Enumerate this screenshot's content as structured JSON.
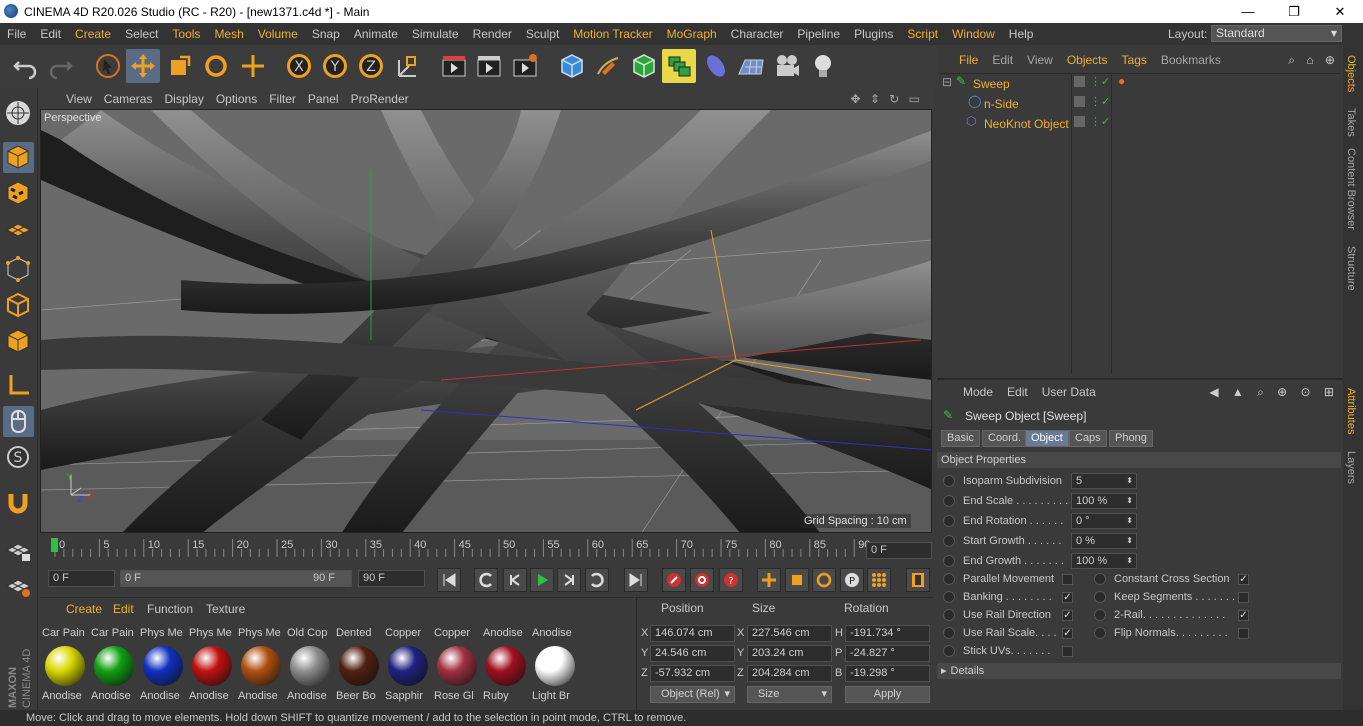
{
  "window": {
    "title": "CINEMA 4D R20.026 Studio (RC - R20) - [new1371.c4d *] - Main",
    "minimize_glyph": "—",
    "maximize_glyph": "❐",
    "close_glyph": "✕"
  },
  "menubar": {
    "items": [
      "File",
      "Edit",
      "Create",
      "Select",
      "Tools",
      "Mesh",
      "Volume",
      "Snap",
      "Animate",
      "Simulate",
      "Render",
      "Sculpt",
      "Motion Tracker",
      "MoGraph",
      "Character",
      "Pipeline",
      "Plugins",
      "Script",
      "Window",
      "Help"
    ],
    "layout_label": "Layout:",
    "layout_value": "Standard"
  },
  "viewport": {
    "menu": [
      "View",
      "Cameras",
      "Display",
      "Options",
      "Filter",
      "Panel",
      "ProRender"
    ],
    "label": "Perspective",
    "grid_spacing": "Grid Spacing : 10 cm",
    "axis_y": "Y",
    "axis_x": "X",
    "axis_z": "Z"
  },
  "timeline": {
    "ticks": [
      "0",
      "5",
      "10",
      "15",
      "20",
      "25",
      "30",
      "35",
      "40",
      "45",
      "50",
      "55",
      "60",
      "65",
      "70",
      "75",
      "80",
      "85",
      "90"
    ],
    "current_frame": "0 F",
    "start": "0 F",
    "range_start": "0 F",
    "range_end": "90 F",
    "end": "90 F"
  },
  "materials": {
    "menu": [
      "Create",
      "Edit",
      "Function",
      "Texture"
    ],
    "top_row": [
      "Car Pain",
      "Car Pain",
      "Phys Me",
      "Phys Me",
      "Phys Me",
      "Old Cop",
      "Dented",
      "Copper",
      "Copper",
      "Anodise",
      "Anodise"
    ],
    "bottom_row": [
      {
        "name": "Anodise",
        "color": "#d8d800"
      },
      {
        "name": "Anodise",
        "color": "#10a010"
      },
      {
        "name": "Anodise",
        "color": "#1030c0"
      },
      {
        "name": "Anodise",
        "color": "#c01010"
      },
      {
        "name": "Anodise",
        "color": "#b05010"
      },
      {
        "name": "Anodise",
        "color": "#909090"
      },
      {
        "name": "Beer Bo",
        "color": "#502010"
      },
      {
        "name": "Sapphir",
        "color": "#202080"
      },
      {
        "name": "Rose Gl",
        "color": "#a03040"
      },
      {
        "name": "Ruby",
        "color": "#a01020"
      },
      {
        "name": "Light Br",
        "color": "#ffffff"
      }
    ]
  },
  "coordinates": {
    "headers": [
      "Position",
      "Size",
      "Rotation"
    ],
    "rows": [
      {
        "axis": "X",
        "pos": "146.074 cm",
        "saxis": "X",
        "size": "227.546 cm",
        "raxis": "H",
        "rot": "-191.734 °"
      },
      {
        "axis": "Y",
        "pos": "24.546 cm",
        "saxis": "Y",
        "size": "203.24 cm",
        "raxis": "P",
        "rot": "-24.827 °"
      },
      {
        "axis": "Z",
        "pos": "-57.932 cm",
        "saxis": "Z",
        "size": "204.284 cm",
        "raxis": "B",
        "rot": "-19.298 °"
      }
    ],
    "mode": "Object (Rel)",
    "size_mode": "Size",
    "apply": "Apply"
  },
  "objects": {
    "menu": [
      "File",
      "Edit",
      "View",
      "Objects",
      "Tags",
      "Bookmarks"
    ],
    "items": [
      "Sweep",
      "n-Side",
      "NeoKnot Object"
    ]
  },
  "attributes": {
    "menu": [
      "Mode",
      "Edit",
      "User Data"
    ],
    "title": "Sweep Object [Sweep]",
    "tabs": [
      "Basic",
      "Coord.",
      "Object",
      "Caps",
      "Phong"
    ],
    "section": "Object Properties",
    "fields": [
      {
        "label": "Isoparm Subdivision",
        "value": "5"
      },
      {
        "label": "End Scale . . . . . . . . . .",
        "value": "100 %"
      },
      {
        "label": "End Rotation . . . . . .",
        "value": "0 °"
      },
      {
        "label": "Start Growth . . . . . .",
        "value": "0 %"
      },
      {
        "label": "End Growth . . . . . . .",
        "value": "100 %"
      }
    ],
    "checks_left": [
      {
        "label": "Parallel Movement",
        "checked": false
      },
      {
        "label": "Banking . . . . . . . .",
        "checked": true
      },
      {
        "label": "Use Rail Direction",
        "checked": true
      },
      {
        "label": "Use Rail Scale. . . .",
        "checked": true
      },
      {
        "label": "Stick UVs. . . . . . .",
        "checked": false
      }
    ],
    "checks_right": [
      {
        "label": "Constant Cross Section",
        "checked": true
      },
      {
        "label": "Keep Segments . . . . . . .",
        "checked": false
      },
      {
        "label": "2-Rail. . . . . . . . . . . . . .",
        "checked": true
      },
      {
        "label": "Flip Normals. . . . . . . . .",
        "checked": false
      }
    ],
    "details": "Details",
    "check_glyph": "✓"
  },
  "right_tabs": [
    "Objects",
    "Takes",
    "Content Browser",
    "Structure",
    "Attributes",
    "Layers"
  ],
  "status": "Move: Click and drag to move elements. Hold down SHIFT to quantize movement / add to the selection in point mode, CTRL to remove.",
  "logo": {
    "maxon": "MAXON",
    "product": "CINEMA 4D"
  }
}
